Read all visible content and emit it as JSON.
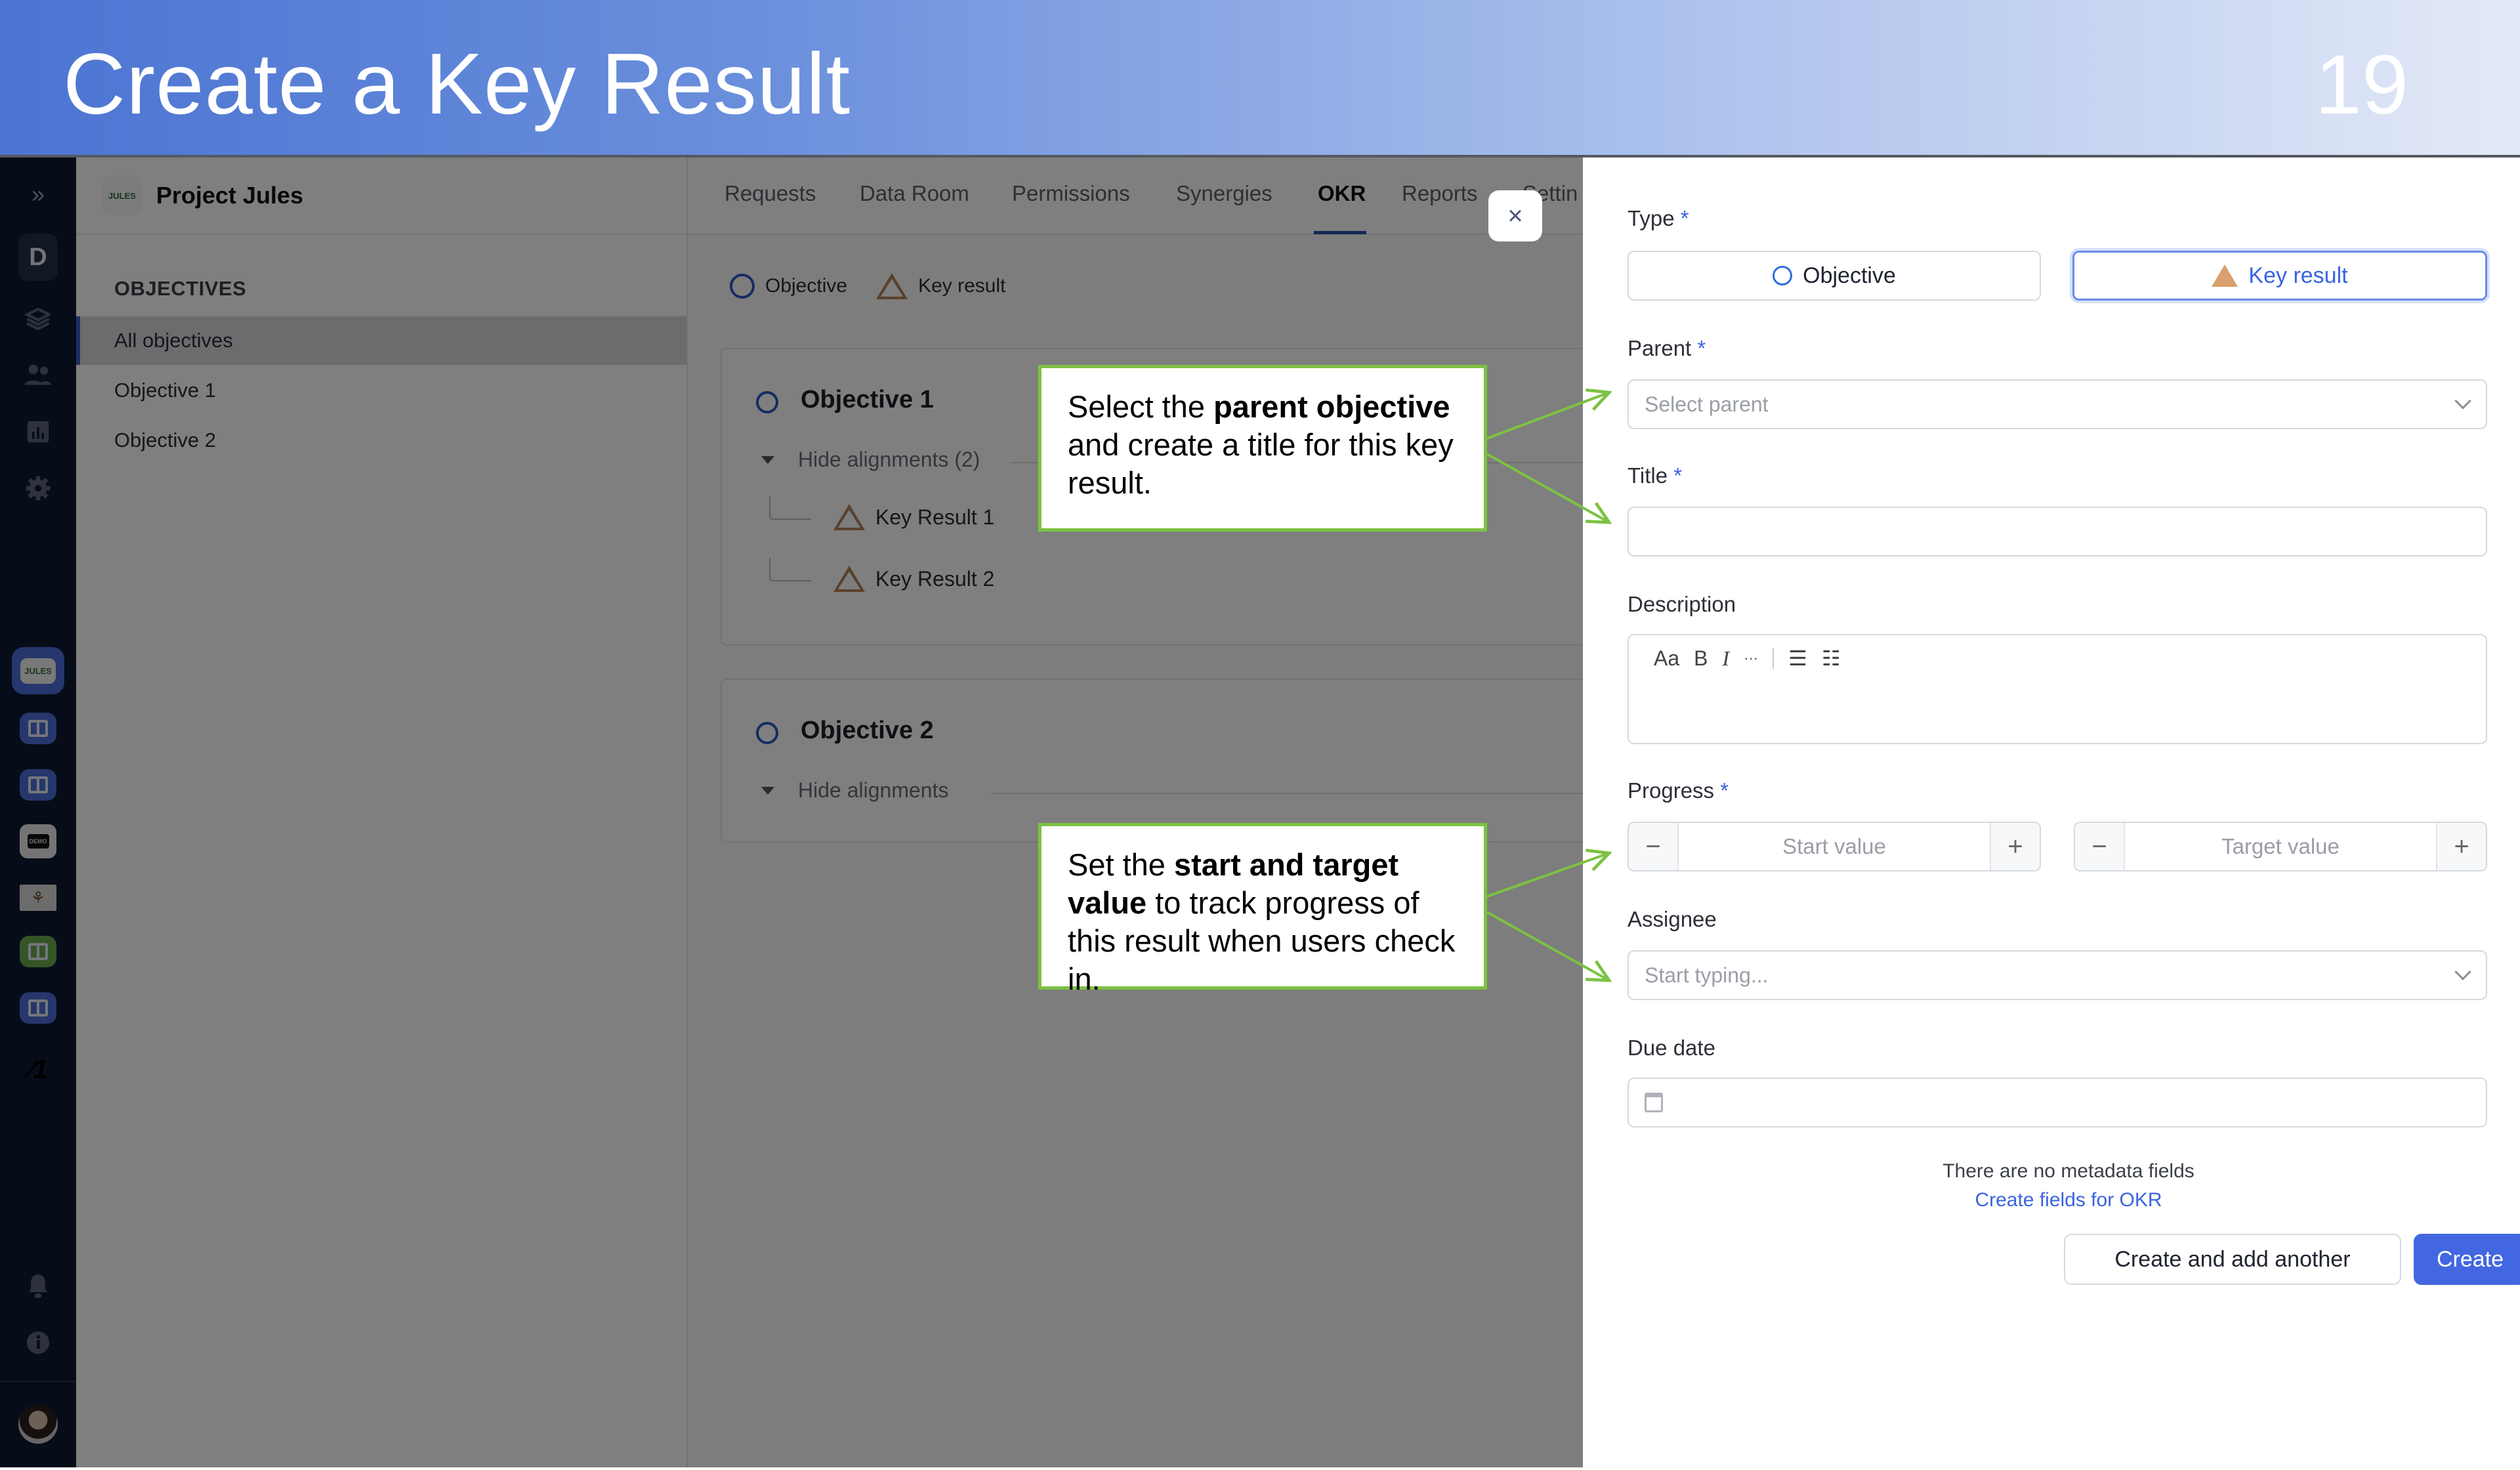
{
  "slide": {
    "title": "Create a Key Result",
    "number": "19"
  },
  "rail": {
    "expand_icon": "double-chevron-right-icon",
    "workspace_letter": "D",
    "nav_icons": [
      "layers-icon",
      "users-icon",
      "chart-icon",
      "gear-icon"
    ],
    "workspaces": [
      "JULES",
      "workspace-2",
      "workspace-3",
      "DEMO",
      "workspace-5",
      "workspace-6",
      "workspace-7",
      "workspace-8"
    ],
    "bottom_icons": [
      "bell-icon",
      "info-icon"
    ]
  },
  "project": {
    "logo": "JULES",
    "name": "Project Jules"
  },
  "sidebar": {
    "section": "OBJECTIVES",
    "items": [
      {
        "label": "All objectives",
        "active": true
      },
      {
        "label": "Objective 1",
        "active": false
      },
      {
        "label": "Objective 2",
        "active": false
      }
    ]
  },
  "tabs": [
    {
      "label": "Requests",
      "active": false
    },
    {
      "label": "Data Room",
      "active": false
    },
    {
      "label": "Permissions",
      "active": false
    },
    {
      "label": "Synergies",
      "active": false
    },
    {
      "label": "OKR",
      "active": true
    },
    {
      "label": "Reports",
      "active": false
    },
    {
      "label": "Settin",
      "active": false
    }
  ],
  "legend": {
    "objective": "Objective",
    "key_result": "Key result"
  },
  "objectives": [
    {
      "title": "Objective 1",
      "alignments_label": "Hide alignments (2)",
      "key_results": [
        "Key Result 1",
        "Key Result 2"
      ]
    },
    {
      "title": "Objective 2",
      "alignments_label": "Hide alignments",
      "key_results": []
    }
  ],
  "form": {
    "type_label": "Type",
    "type_options": [
      {
        "label": "Objective",
        "selected": false
      },
      {
        "label": "Key result",
        "selected": true
      }
    ],
    "parent_label": "Parent",
    "parent_placeholder": "Select parent",
    "title_label": "Title",
    "title_value": "",
    "description_label": "Description",
    "toolbar": {
      "font": "Aa",
      "bold": "B",
      "italic": "I",
      "more": "···",
      "bullet": "☰",
      "numbered": "☷"
    },
    "progress_label": "Progress",
    "start_placeholder": "Start value",
    "target_placeholder": "Target value",
    "minus": "−",
    "plus": "+",
    "assignee_label": "Assignee",
    "assignee_placeholder": "Start typing...",
    "due_date_label": "Due date",
    "required_mark": "*",
    "metadata_note": "There are no metadata fields",
    "metadata_link": "Create fields for OKR",
    "secondary_button": "Create and add another",
    "primary_button": "Create",
    "close": "×"
  },
  "callouts": {
    "parent": {
      "pre": "Select the ",
      "bold": "parent objective",
      "post": " and create a title for this key result."
    },
    "progress": {
      "pre": "Set the ",
      "bold": "start and target value",
      "post": " to track progress of this result when users check in."
    }
  },
  "colors": {
    "accent": "#4267e0",
    "callout_border": "#7cc242",
    "rail": "#0d1a33",
    "key_result": "#d9a06d"
  }
}
